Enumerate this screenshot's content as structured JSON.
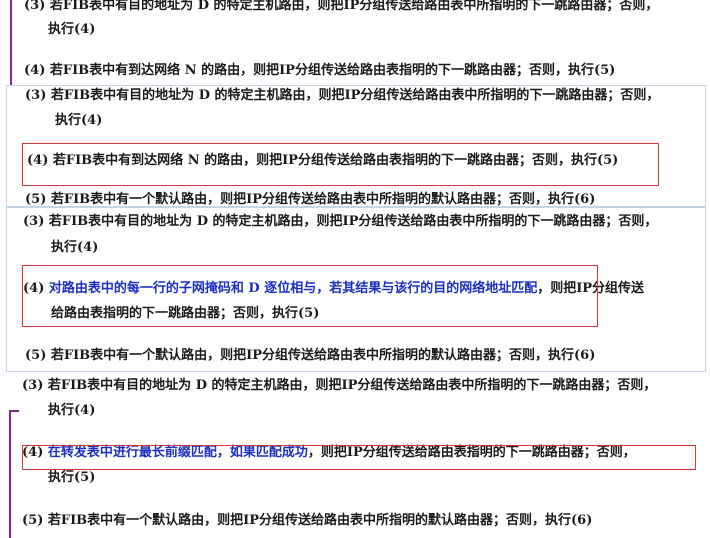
{
  "block1": {
    "line3a": "(3) 若FIB表中有目的地址为 D 的特定主机路由，则把IP分组传送给路由表中所指明的下一跳路由器；否则，",
    "line3b": "执行(4)",
    "line4": "(4) 若FIB表中有到达网络 N 的路由，则把IP分组传送给路由表指明的下一跳路由器；否则，执行(5)"
  },
  "block2": {
    "line3a": "(3) 若FIB表中有目的地址为 D 的特定主机路由，则把IP分组传送给路由表中所指明的下一跳路由器；否则，",
    "line3b": "执行(4)",
    "line4": "(4) 若FIB表中有到达网络 N 的路由，则把IP分组传送给路由表指明的下一跳路由器；否则，执行(5)",
    "line5": "(5) 若FIB表中有一个默认路由，则把IP分组传送给路由表中所指明的默认路由器；否则，执行(6)"
  },
  "block3": {
    "line3a": "(3) 若FIB表中有目的地址为 D 的特定主机路由，则把IP分组传送给路由表中所指明的下一跳路由器；否则，",
    "line3b": "执行(4)",
    "line4_prefix": "(4) ",
    "line4_blue": "对路由表中的每一行的子网掩码和 D 逐位相与，若其结果与该行的目的网络地址匹配",
    "line4_rest": "，则把IP分组传送",
    "line4b": "给路由表指明的下一跳路由器；否则，执行(5)",
    "line5": "(5) 若FIB表中有一个默认路由，则把IP分组传送给路由表中所指明的默认路由器；否则，执行(6)"
  },
  "block4": {
    "line3a": "(3) 若FIB表中有目的地址为 D 的特定主机路由，则把IP分组传送给路由表中所指明的下一跳路由器；否则，",
    "line3b": "执行(4)",
    "line4_prefix": "(4) ",
    "line4_blue": "在转发表中进行最长前缀匹配，如果匹配成功",
    "line4_rest": "，则把IP分组传送给路由表指明的下一跳路由器；否则，",
    "line4b": "执行(5)",
    "line5": "(5) 若FIB表中有一个默认路由，则把IP分组传送给路由表中所指明的默认路由器；否则，执行(6)"
  },
  "colors": {
    "connector": "#7e2b8e",
    "highlight_text": "#1a2fc4",
    "highlight_box": "#d03a3a",
    "panel_border": "#c6d4ea"
  }
}
